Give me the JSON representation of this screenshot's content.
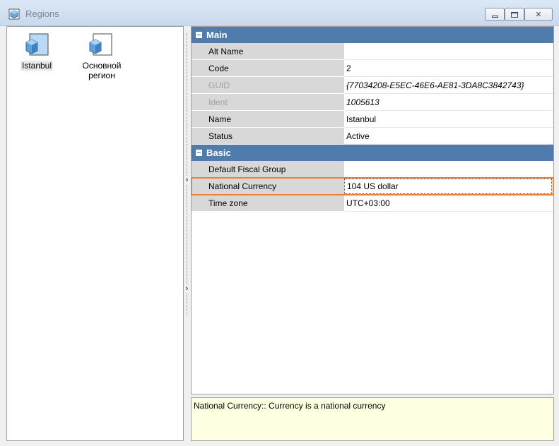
{
  "window": {
    "title": "Regions",
    "minimize_icon": "minimize-icon",
    "maximize_icon": "maximize-icon",
    "close_label": "✕"
  },
  "list": {
    "items": [
      {
        "label": "Istanbul",
        "icon": "region-cube-icon",
        "selected": true
      },
      {
        "label": "Основной регион",
        "icon": "region-cube-icon",
        "selected": false
      }
    ]
  },
  "grid": {
    "categories": [
      {
        "label": "Main",
        "rows": [
          {
            "name": "Alt Name",
            "value": ""
          },
          {
            "name": "Code",
            "value": "2"
          },
          {
            "name": "GUID",
            "value": "{77034208-E5EC-46E6-AE81-3DA8C3842743}"
          },
          {
            "name": "Ident",
            "value": "1005613"
          },
          {
            "name": "Name",
            "value": "Istanbul"
          },
          {
            "name": "Status",
            "value": "Active"
          }
        ]
      },
      {
        "label": "Basic",
        "rows": [
          {
            "name": "Default Fiscal Group",
            "value": ""
          },
          {
            "name": "National Currency",
            "value": "104 US dollar"
          },
          {
            "name": "Time zone",
            "value": "UTC+03:00"
          }
        ]
      }
    ]
  },
  "description": "National Currency:: Currency is a national currency",
  "colors": {
    "category_header": "#4f7cac",
    "highlight": "#f07e2c",
    "description_bg": "#ffffe1"
  }
}
